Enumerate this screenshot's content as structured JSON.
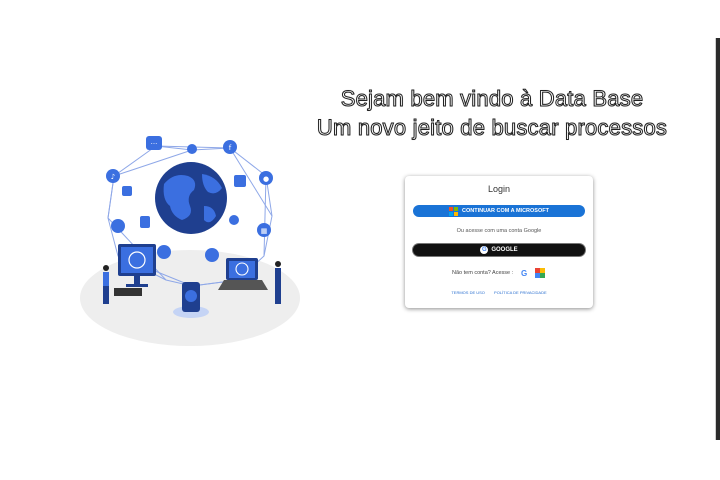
{
  "hero": {
    "title_line1": "Sejam bem vindo à Data Base",
    "title_line2": "Um novo jeito de buscar processos"
  },
  "login": {
    "title": "Login",
    "microsoft_button": "CONTINUAR COM A MICROSOFT",
    "or_text": "Ou acesse com uma conta Google",
    "google_button": "GOOGLE",
    "no_account_text": "Não tem conta? Acesse :",
    "footer": {
      "terms": "TERMOS DE USO",
      "privacy": "POLÍTICA DE PRIVACIDADE"
    }
  },
  "colors": {
    "microsoft_button": "#1a73d6",
    "google_button": "#111111",
    "illustration_blue": "#3b6fe0",
    "link": "#2a6fd0"
  },
  "icons": [
    "network-illustration",
    "microsoft-logo-icon",
    "google-logo-icon",
    "google-g-icon",
    "google-workspace-icon"
  ]
}
